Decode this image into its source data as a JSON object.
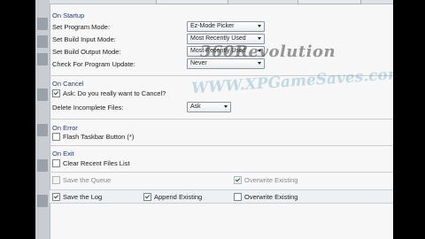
{
  "tabs": [
    "",
    ""
  ],
  "startup": {
    "header": "On Startup",
    "program_mode": {
      "label": "Set Program Mode:",
      "value": "Ez-Mode Picker"
    },
    "build_input_mode": {
      "label": "Set Build Input Mode:",
      "value": "Most Recently Used"
    },
    "build_output_mode": {
      "label": "Set Build Output Mode:",
      "value": "Most Recently Used"
    },
    "check_update": {
      "label": "Check For Program Update:",
      "value": "Never"
    }
  },
  "cancel": {
    "header": "On Cancel",
    "ask_checkbox": {
      "label": "Ask: Do you really want to Cancel?",
      "checked": true
    },
    "delete_incomplete": {
      "label": "Delete Incomplete Files:",
      "value": "Ask"
    }
  },
  "error": {
    "header": "On Error",
    "flash_taskbar": {
      "label": "Flash Taskbar Button (*)",
      "checked": false
    }
  },
  "exit": {
    "header": "On Exit",
    "clear_recent": {
      "label": "Clear Recent Files List",
      "checked": false
    }
  },
  "queue": {
    "save_queue": {
      "label": "Save the Queue",
      "checked": false
    },
    "overwrite_existing": {
      "label": "Overwrite Existing",
      "checked": true
    }
  },
  "log": {
    "save_log": {
      "label": "Save the Log",
      "checked": true
    },
    "append_existing": {
      "label": "Append Existing",
      "checked": true
    },
    "overwrite_existing": {
      "label": "Overwrite Existing",
      "checked": false
    }
  },
  "watermarks": {
    "brand": "360Revolution",
    "site": "WWW.XPGameSaves.com"
  }
}
